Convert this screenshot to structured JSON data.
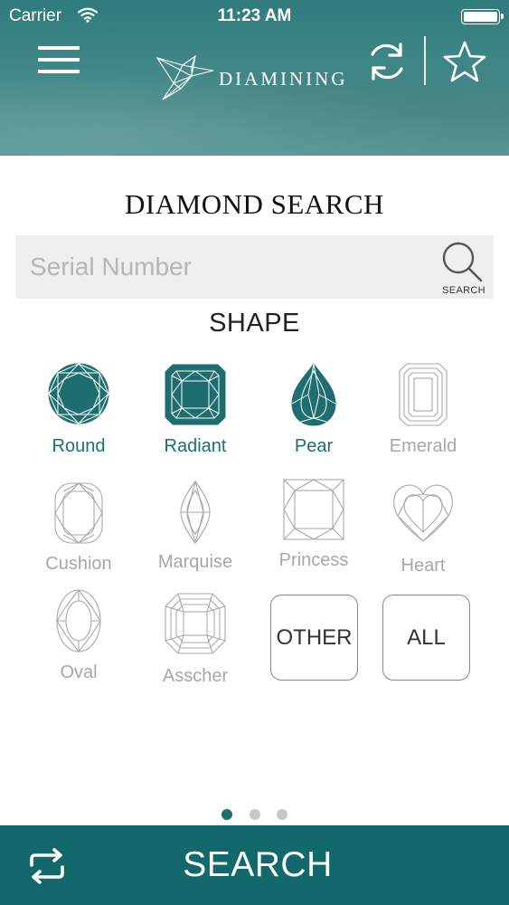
{
  "status_bar": {
    "carrier": "Carrier",
    "time": "11:23 AM",
    "battery_level": 1.0
  },
  "header": {
    "brand": "DIAMINING",
    "icons": {
      "menu": "hamburger-menu-icon",
      "logo": "origami-bird-logo-icon",
      "refresh": "refresh-icon",
      "favorite": "star-icon"
    }
  },
  "page": {
    "title": "DIAMOND SEARCH"
  },
  "serial_search": {
    "placeholder": "Serial Number",
    "value": "",
    "button_label": "SEARCH",
    "icon": "magnifier-icon"
  },
  "shape_section": {
    "heading": "SHAPE",
    "shapes": [
      {
        "label": "Round",
        "selected": true
      },
      {
        "label": "Radiant",
        "selected": true
      },
      {
        "label": "Pear",
        "selected": true
      },
      {
        "label": "Emerald",
        "selected": false
      },
      {
        "label": "Cushion",
        "selected": false
      },
      {
        "label": "Marquise",
        "selected": false
      },
      {
        "label": "Princess",
        "selected": false
      },
      {
        "label": "Heart",
        "selected": false
      },
      {
        "label": "Oval",
        "selected": false
      },
      {
        "label": "Asscher",
        "selected": false
      }
    ],
    "other_label": "OTHER",
    "all_label": "ALL"
  },
  "pagination": {
    "current_page": 1,
    "total_pages": 3
  },
  "bottom_bar": {
    "search_label": "SEARCH",
    "reset_icon": "repeat-arrows-icon"
  },
  "colors": {
    "header_teal": "#3f8787",
    "accent_teal": "#12686a",
    "selected_text": "#1e6e70",
    "inactive_text": "#a7a7a7",
    "search_field_bg": "#efefef"
  }
}
